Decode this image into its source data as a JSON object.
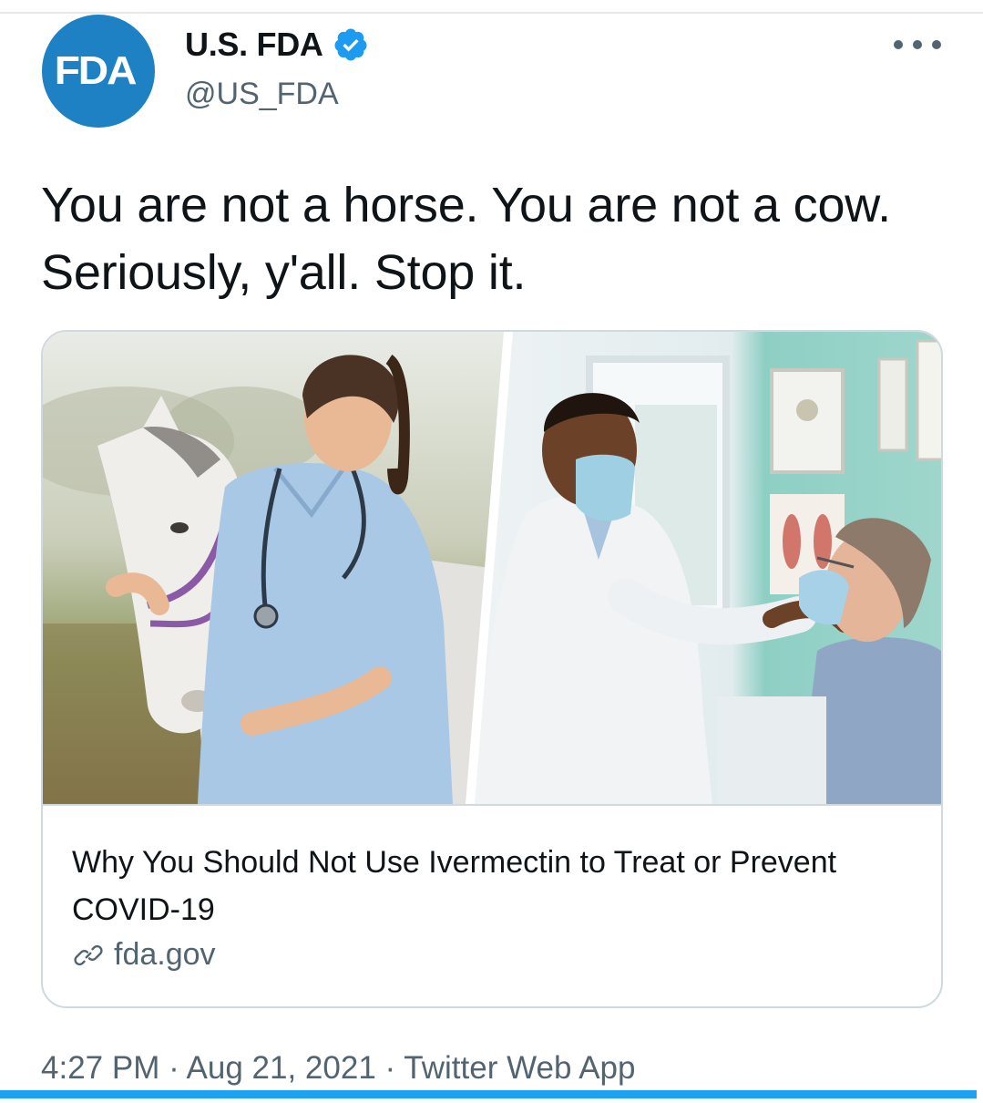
{
  "author": {
    "avatar_text": "FDA",
    "display_name": "U.S. FDA",
    "handle": "@US_FDA",
    "verified": true
  },
  "tweet": {
    "text": "You are not a horse. You are not a cow. Seriously, y'all. Stop it."
  },
  "card": {
    "title": "Why You Should Not Use Ivermectin to Treat or Prevent COVID-19",
    "domain": "fda.gov"
  },
  "meta": {
    "time": "4:27 PM",
    "date": "Aug 21, 2021",
    "source": "Twitter Web App",
    "separator": "·"
  },
  "colors": {
    "accent": "#1da1f2",
    "avatar_bg": "#1d81c4",
    "secondary_text": "#536471",
    "border": "#cfd9de"
  },
  "icons": {
    "verified": "verified-badge-icon",
    "more": "more-options-icon",
    "link": "link-icon"
  }
}
